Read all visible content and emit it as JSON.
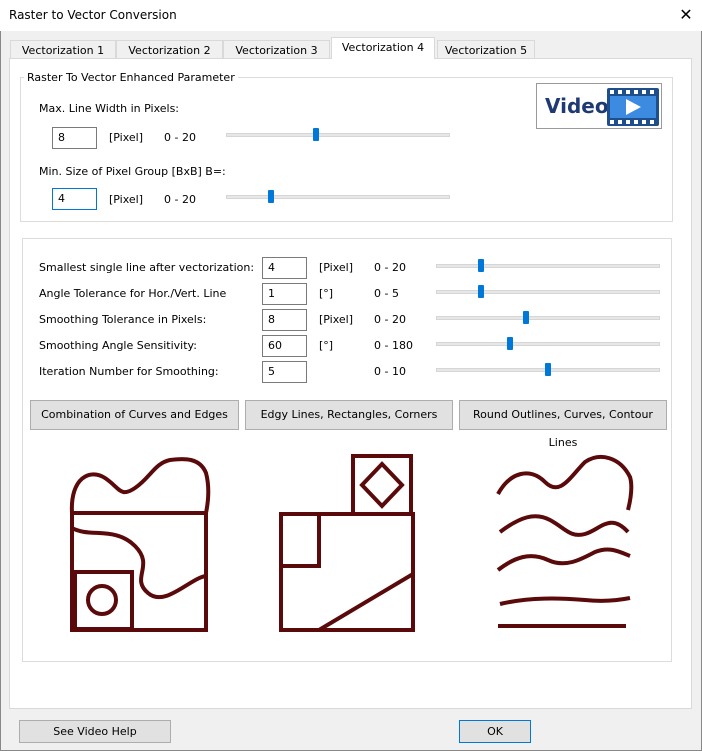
{
  "window": {
    "title": "Raster to Vector Conversion"
  },
  "tabs": [
    "Vectorization 1",
    "Vectorization 2",
    "Vectorization 3",
    "Vectorization 4",
    "Vectorization 5"
  ],
  "enhanced": {
    "group_label": "Raster To Vector Enhanced Parameter",
    "video_label": "Video",
    "max_line": {
      "label": "Max. Line Width in Pixels:",
      "value": "8",
      "unit": "[Pixel]",
      "range": "0 - 20",
      "level": 0.4
    },
    "min_group": {
      "label": "Min. Size of Pixel Group [BxB] B=:",
      "value": "4",
      "unit": "[Pixel]",
      "range": "0 - 20",
      "level": 0.2
    }
  },
  "params": [
    {
      "label": "Smallest single line after vectorization:",
      "value": "4",
      "unit": "[Pixel]",
      "range": "0 - 20",
      "level": 0.2
    },
    {
      "label": "Angle Tolerance for Hor./Vert. Line",
      "value": "1",
      "unit": "[°]",
      "range": "0 - 5",
      "level": 0.2
    },
    {
      "label": "Smoothing Tolerance in Pixels:",
      "value": "8",
      "unit": "[Pixel]",
      "range": "0 - 20",
      "level": 0.4
    },
    {
      "label": "Smoothing Angle Sensitivity:",
      "value": "60",
      "unit": "[°]",
      "range": "0 - 180",
      "level": 0.33
    },
    {
      "label": "Iteration Number for Smoothing:",
      "value": "5",
      "unit": "",
      "range": "0 - 10",
      "level": 0.5
    }
  ],
  "presets": [
    "Combination of Curves and Edges",
    "Edgy Lines, Rectangles, Corners",
    "Round Outlines, Curves, Contour Lines"
  ],
  "footer": {
    "help_label": "See Video Help",
    "ok_label": "OK"
  },
  "colors": {
    "accent": "#0078d7",
    "illustration": "#5a0a0a"
  }
}
